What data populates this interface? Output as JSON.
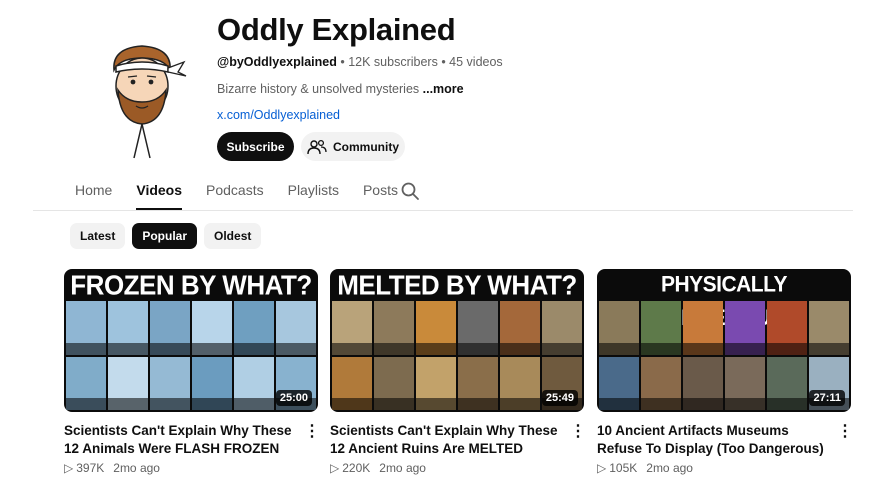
{
  "channel": {
    "title": "Oddly Explained",
    "handle": "@byOddlyexplained",
    "subscribers": "12K subscribers",
    "videos_count": "45 videos",
    "description": "Bizarre history &  unsolved mysteries",
    "more_label": "...more",
    "link": "x.com/Oddlyexplained"
  },
  "buttons": {
    "subscribe": "Subscribe",
    "community": "Community"
  },
  "tabs": [
    "Home",
    "Videos",
    "Posts",
    "Playlists",
    "Posts"
  ],
  "tab_labels": {
    "home": "Home",
    "videos": "Videos",
    "podcasts": "Podcasts",
    "playlists": "Playlists",
    "posts": "Posts"
  },
  "chips": {
    "latest": "Latest",
    "popular": "Popular",
    "oldest": "Oldest"
  },
  "videos": [
    {
      "thumb_title": "FROZEN BY WHAT?",
      "duration": "25:00",
      "title": "Scientists Can't Explain Why These 12 Animals Were FLASH FROZEN",
      "views": "397K",
      "age": "2mo ago",
      "colors": [
        "#8fb6d3",
        "#9ec3dd",
        "#7aa5c5",
        "#b8d5ea",
        "#6f9fc0",
        "#a7c7de",
        "#80acc9",
        "#c3dbec",
        "#95bad4",
        "#6b9cbf",
        "#b0cfe4",
        "#88b2cf"
      ]
    },
    {
      "thumb_title": "MELTED BY WHAT?",
      "duration": "25:49",
      "title": "Scientists Can't Explain Why These 12 Ancient Ruins Are MELTED",
      "views": "220K",
      "age": "2mo ago",
      "colors": [
        "#b9a37a",
        "#8d7a5b",
        "#c98a3a",
        "#6a6a6a",
        "#a4683a",
        "#9b8a6a",
        "#b07a3a",
        "#7d6b4f",
        "#c2a26a",
        "#8a6e4a",
        "#a88a5a",
        "#6f5a3e"
      ]
    },
    {
      "thumb_title": "PHYSICALLY DANGEROUS?",
      "duration": "27:11",
      "title": "10 Ancient Artifacts Museums Refuse To Display (Too Dangerous)",
      "views": "105K",
      "age": "2mo ago",
      "colors": [
        "#8a7a5a",
        "#5e7a4a",
        "#c87a3a",
        "#7a4ab0",
        "#b04a2a",
        "#9a8a6a",
        "#4a6a8a",
        "#8a6a4a",
        "#6a5a4a",
        "#7a6a5a",
        "#5a6a5a",
        "#9ab0c0"
      ]
    }
  ]
}
